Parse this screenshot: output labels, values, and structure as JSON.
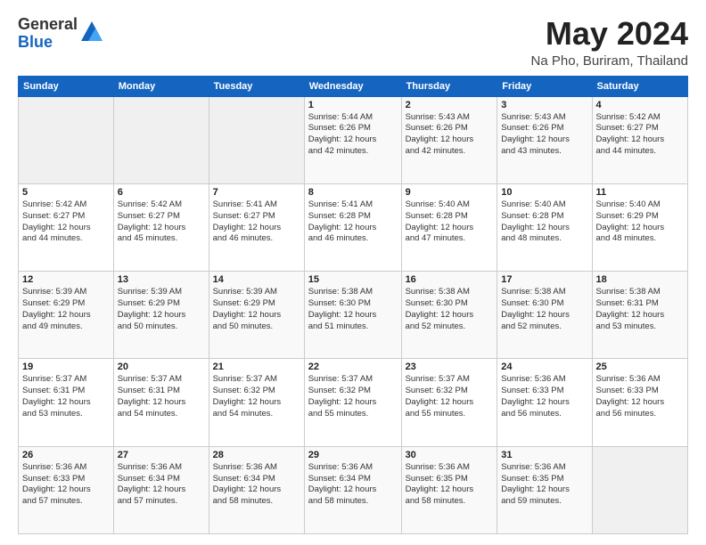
{
  "logo": {
    "line1": "General",
    "line2": "Blue"
  },
  "header": {
    "month": "May 2024",
    "location": "Na Pho, Buriram, Thailand"
  },
  "weekdays": [
    "Sunday",
    "Monday",
    "Tuesday",
    "Wednesday",
    "Thursday",
    "Friday",
    "Saturday"
  ],
  "weeks": [
    [
      {
        "day": "",
        "info": ""
      },
      {
        "day": "",
        "info": ""
      },
      {
        "day": "",
        "info": ""
      },
      {
        "day": "1",
        "info": "Sunrise: 5:44 AM\nSunset: 6:26 PM\nDaylight: 12 hours\nand 42 minutes."
      },
      {
        "day": "2",
        "info": "Sunrise: 5:43 AM\nSunset: 6:26 PM\nDaylight: 12 hours\nand 42 minutes."
      },
      {
        "day": "3",
        "info": "Sunrise: 5:43 AM\nSunset: 6:26 PM\nDaylight: 12 hours\nand 43 minutes."
      },
      {
        "day": "4",
        "info": "Sunrise: 5:42 AM\nSunset: 6:27 PM\nDaylight: 12 hours\nand 44 minutes."
      }
    ],
    [
      {
        "day": "5",
        "info": "Sunrise: 5:42 AM\nSunset: 6:27 PM\nDaylight: 12 hours\nand 44 minutes."
      },
      {
        "day": "6",
        "info": "Sunrise: 5:42 AM\nSunset: 6:27 PM\nDaylight: 12 hours\nand 45 minutes."
      },
      {
        "day": "7",
        "info": "Sunrise: 5:41 AM\nSunset: 6:27 PM\nDaylight: 12 hours\nand 46 minutes."
      },
      {
        "day": "8",
        "info": "Sunrise: 5:41 AM\nSunset: 6:28 PM\nDaylight: 12 hours\nand 46 minutes."
      },
      {
        "day": "9",
        "info": "Sunrise: 5:40 AM\nSunset: 6:28 PM\nDaylight: 12 hours\nand 47 minutes."
      },
      {
        "day": "10",
        "info": "Sunrise: 5:40 AM\nSunset: 6:28 PM\nDaylight: 12 hours\nand 48 minutes."
      },
      {
        "day": "11",
        "info": "Sunrise: 5:40 AM\nSunset: 6:29 PM\nDaylight: 12 hours\nand 48 minutes."
      }
    ],
    [
      {
        "day": "12",
        "info": "Sunrise: 5:39 AM\nSunset: 6:29 PM\nDaylight: 12 hours\nand 49 minutes."
      },
      {
        "day": "13",
        "info": "Sunrise: 5:39 AM\nSunset: 6:29 PM\nDaylight: 12 hours\nand 50 minutes."
      },
      {
        "day": "14",
        "info": "Sunrise: 5:39 AM\nSunset: 6:29 PM\nDaylight: 12 hours\nand 50 minutes."
      },
      {
        "day": "15",
        "info": "Sunrise: 5:38 AM\nSunset: 6:30 PM\nDaylight: 12 hours\nand 51 minutes."
      },
      {
        "day": "16",
        "info": "Sunrise: 5:38 AM\nSunset: 6:30 PM\nDaylight: 12 hours\nand 52 minutes."
      },
      {
        "day": "17",
        "info": "Sunrise: 5:38 AM\nSunset: 6:30 PM\nDaylight: 12 hours\nand 52 minutes."
      },
      {
        "day": "18",
        "info": "Sunrise: 5:38 AM\nSunset: 6:31 PM\nDaylight: 12 hours\nand 53 minutes."
      }
    ],
    [
      {
        "day": "19",
        "info": "Sunrise: 5:37 AM\nSunset: 6:31 PM\nDaylight: 12 hours\nand 53 minutes."
      },
      {
        "day": "20",
        "info": "Sunrise: 5:37 AM\nSunset: 6:31 PM\nDaylight: 12 hours\nand 54 minutes."
      },
      {
        "day": "21",
        "info": "Sunrise: 5:37 AM\nSunset: 6:32 PM\nDaylight: 12 hours\nand 54 minutes."
      },
      {
        "day": "22",
        "info": "Sunrise: 5:37 AM\nSunset: 6:32 PM\nDaylight: 12 hours\nand 55 minutes."
      },
      {
        "day": "23",
        "info": "Sunrise: 5:37 AM\nSunset: 6:32 PM\nDaylight: 12 hours\nand 55 minutes."
      },
      {
        "day": "24",
        "info": "Sunrise: 5:36 AM\nSunset: 6:33 PM\nDaylight: 12 hours\nand 56 minutes."
      },
      {
        "day": "25",
        "info": "Sunrise: 5:36 AM\nSunset: 6:33 PM\nDaylight: 12 hours\nand 56 minutes."
      }
    ],
    [
      {
        "day": "26",
        "info": "Sunrise: 5:36 AM\nSunset: 6:33 PM\nDaylight: 12 hours\nand 57 minutes."
      },
      {
        "day": "27",
        "info": "Sunrise: 5:36 AM\nSunset: 6:34 PM\nDaylight: 12 hours\nand 57 minutes."
      },
      {
        "day": "28",
        "info": "Sunrise: 5:36 AM\nSunset: 6:34 PM\nDaylight: 12 hours\nand 58 minutes."
      },
      {
        "day": "29",
        "info": "Sunrise: 5:36 AM\nSunset: 6:34 PM\nDaylight: 12 hours\nand 58 minutes."
      },
      {
        "day": "30",
        "info": "Sunrise: 5:36 AM\nSunset: 6:35 PM\nDaylight: 12 hours\nand 58 minutes."
      },
      {
        "day": "31",
        "info": "Sunrise: 5:36 AM\nSunset: 6:35 PM\nDaylight: 12 hours\nand 59 minutes."
      },
      {
        "day": "",
        "info": ""
      }
    ]
  ]
}
